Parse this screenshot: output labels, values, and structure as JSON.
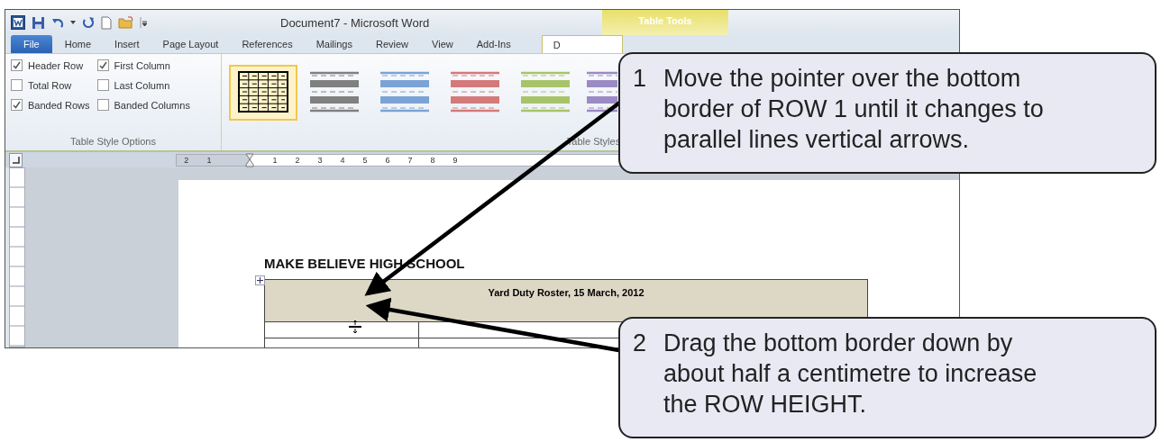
{
  "window": {
    "title": "Document7 - Microsoft Word",
    "contextual_tab": "Table Tools"
  },
  "tabs": [
    {
      "label": "File",
      "kind": "file",
      "selected": false
    },
    {
      "label": "Home",
      "kind": "tab",
      "selected": false
    },
    {
      "label": "Insert",
      "kind": "tab",
      "selected": false
    },
    {
      "label": "Page Layout",
      "kind": "tab",
      "selected": false
    },
    {
      "label": "References",
      "kind": "tab",
      "selected": false
    },
    {
      "label": "Mailings",
      "kind": "tab",
      "selected": false
    },
    {
      "label": "Review",
      "kind": "tab",
      "selected": false
    },
    {
      "label": "View",
      "kind": "tab",
      "selected": false
    },
    {
      "label": "Add-Ins",
      "kind": "tab",
      "selected": false
    },
    {
      "label": "D",
      "kind": "contextual",
      "selected": true
    }
  ],
  "style_options": {
    "title": "Table Style Options",
    "items": [
      {
        "label": "Header Row",
        "checked": true
      },
      {
        "label": "Total Row",
        "checked": false
      },
      {
        "label": "Banded Rows",
        "checked": true
      },
      {
        "label": "First Column",
        "checked": true
      },
      {
        "label": "Last Column",
        "checked": false
      },
      {
        "label": "Banded Columns",
        "checked": false
      }
    ]
  },
  "table_styles": {
    "title": "Table Styles",
    "items": [
      {
        "kind": "grid",
        "color": "#000000",
        "selected": true
      },
      {
        "kind": "banded",
        "color": "#808080",
        "selected": false
      },
      {
        "kind": "banded",
        "color": "#7ba3d6",
        "selected": false
      },
      {
        "kind": "banded",
        "color": "#d47a7a",
        "selected": false
      },
      {
        "kind": "banded",
        "color": "#a8c46a",
        "selected": false
      },
      {
        "kind": "banded",
        "color": "#9b8ac4",
        "selected": false
      }
    ]
  },
  "ruler": {
    "labels": [
      "2",
      "1",
      "1",
      "2",
      "3",
      "4",
      "5",
      "6",
      "7",
      "8",
      "9"
    ]
  },
  "document": {
    "heading": "MAKE BELIEVE HIGH SCHOOL",
    "table_title": "Yard Duty Roster, 15 March, 2012"
  },
  "callouts": [
    {
      "number": "1",
      "text": "Move the pointer over the bottom border of ROW 1 until it changes to parallel lines vertical arrows."
    },
    {
      "number": "2",
      "text": "Drag the bottom border down by about half a centimetre to increase the ROW HEIGHT."
    }
  ]
}
